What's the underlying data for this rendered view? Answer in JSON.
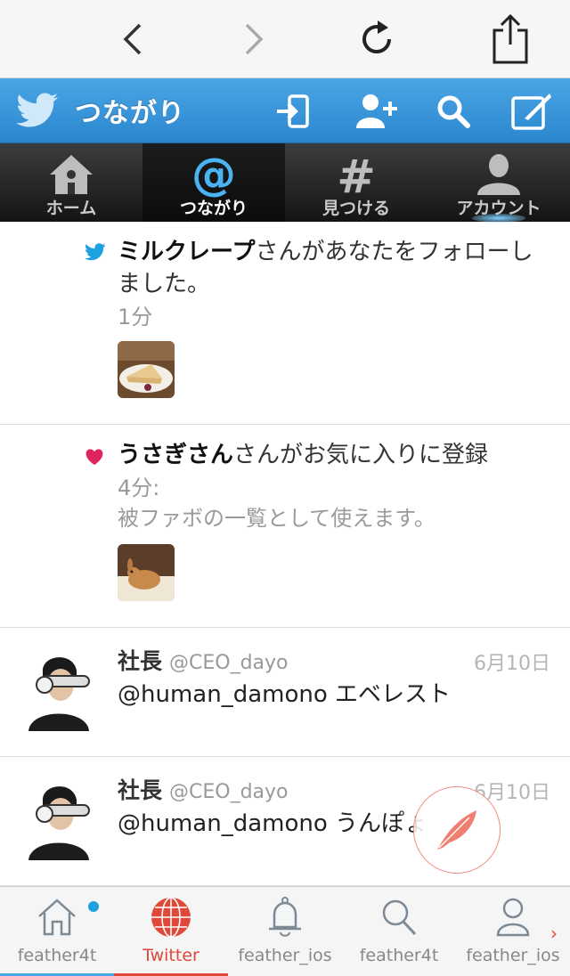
{
  "browser": {
    "back_icon": "chevron-left-icon",
    "forward_icon": "chevron-right-icon",
    "reload_icon": "reload-icon",
    "share_icon": "share-icon"
  },
  "header": {
    "title": "つながり",
    "buttons": [
      "login-icon",
      "add-user-icon",
      "search-icon",
      "compose-icon"
    ],
    "gradient": [
      "#4aa6e4",
      "#2b86cf"
    ]
  },
  "tabs": [
    {
      "label": "ホーム",
      "icon": "home-icon"
    },
    {
      "label": "つながり",
      "icon": "at-icon",
      "active": true
    },
    {
      "label": "見つける",
      "icon": "hashtag-icon"
    },
    {
      "label": "アカウント",
      "icon": "person-icon"
    }
  ],
  "timeline": {
    "follow": {
      "user": "ミルクレープ",
      "text": "さんがあなたをフォローしました。",
      "time": "1分"
    },
    "favorite": {
      "user": "うさぎさん",
      "text": "さんがお気に入りに登録",
      "time": "4分:",
      "tweet": "被ファボの一覧として使えます。"
    },
    "tweets": [
      {
        "name": "社長",
        "handle": "@CEO_dayo",
        "date": "6月10日",
        "text": "@human_damono エベレスト"
      },
      {
        "name": "社長",
        "handle": "@CEO_dayo",
        "date": "6月10日",
        "text": "@human_damono うんぽょ"
      }
    ]
  },
  "bottom_nav": [
    {
      "label": "feather4t",
      "icon": "home-outline-icon",
      "badge": true
    },
    {
      "label": "Twitter",
      "icon": "globe-icon",
      "active": true
    },
    {
      "label": "feather_ios",
      "icon": "bell-icon"
    },
    {
      "label": "feather4t",
      "icon": "search-outline-icon"
    },
    {
      "label": "feather_ios",
      "icon": "person-outline-icon"
    }
  ],
  "colors": {
    "twitter_blue": "#1da1e0",
    "heart": "#e0245e",
    "accent_red": "#e0483a"
  }
}
